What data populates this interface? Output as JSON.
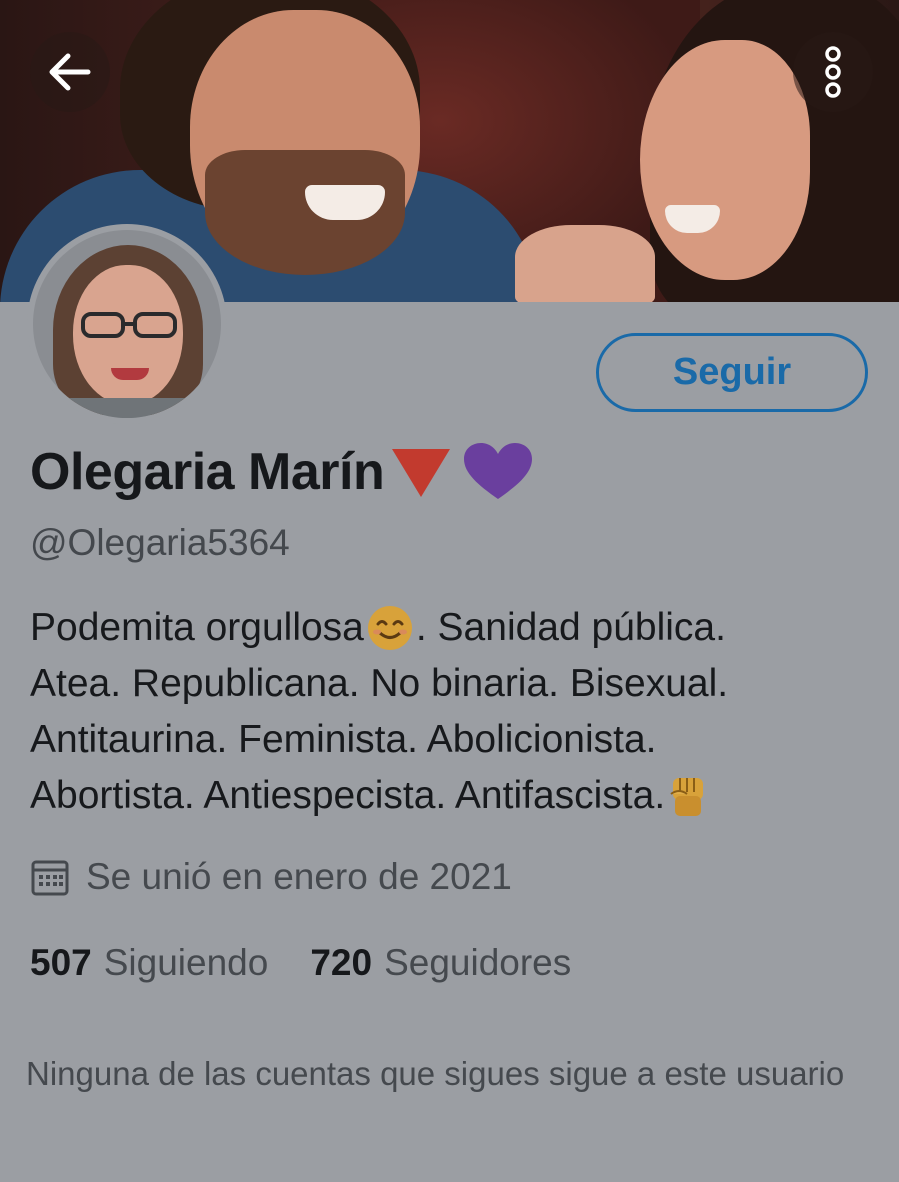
{
  "profile": {
    "display_name": "Olegaria Marín",
    "handle": "@Olegaria5364",
    "follow_label": "Seguir",
    "bio_lines": [
      "Podemita orgullosa",
      ". Sanidad pública.",
      "Atea. Republicana. No binaria. Bisexual.",
      "Antitaurina. Feminista. Abolicionista.",
      "Abortista. Antiespecista. Antifascista."
    ],
    "joined": "Se unió en enero de 2021",
    "following_count": "507",
    "following_label": "Siguiendo",
    "followers_count": "720",
    "followers_label": "Seguidores",
    "no_mutual_follow": "Ninguna de las cuentas que sigues sigue a este usuario"
  },
  "icons": {
    "back": "back-arrow-icon",
    "more": "more-options-icon",
    "calendar": "calendar-icon",
    "name_flair": [
      "red-triangle-icon",
      "purple-heart-icon"
    ],
    "bio_emoji": [
      "smiling-face-icon",
      "raised-fist-icon"
    ]
  },
  "colors": {
    "accent": "#1a6aa8",
    "background": "#9b9ea3",
    "text": "#16181b",
    "secondary_text": "#45494e"
  }
}
